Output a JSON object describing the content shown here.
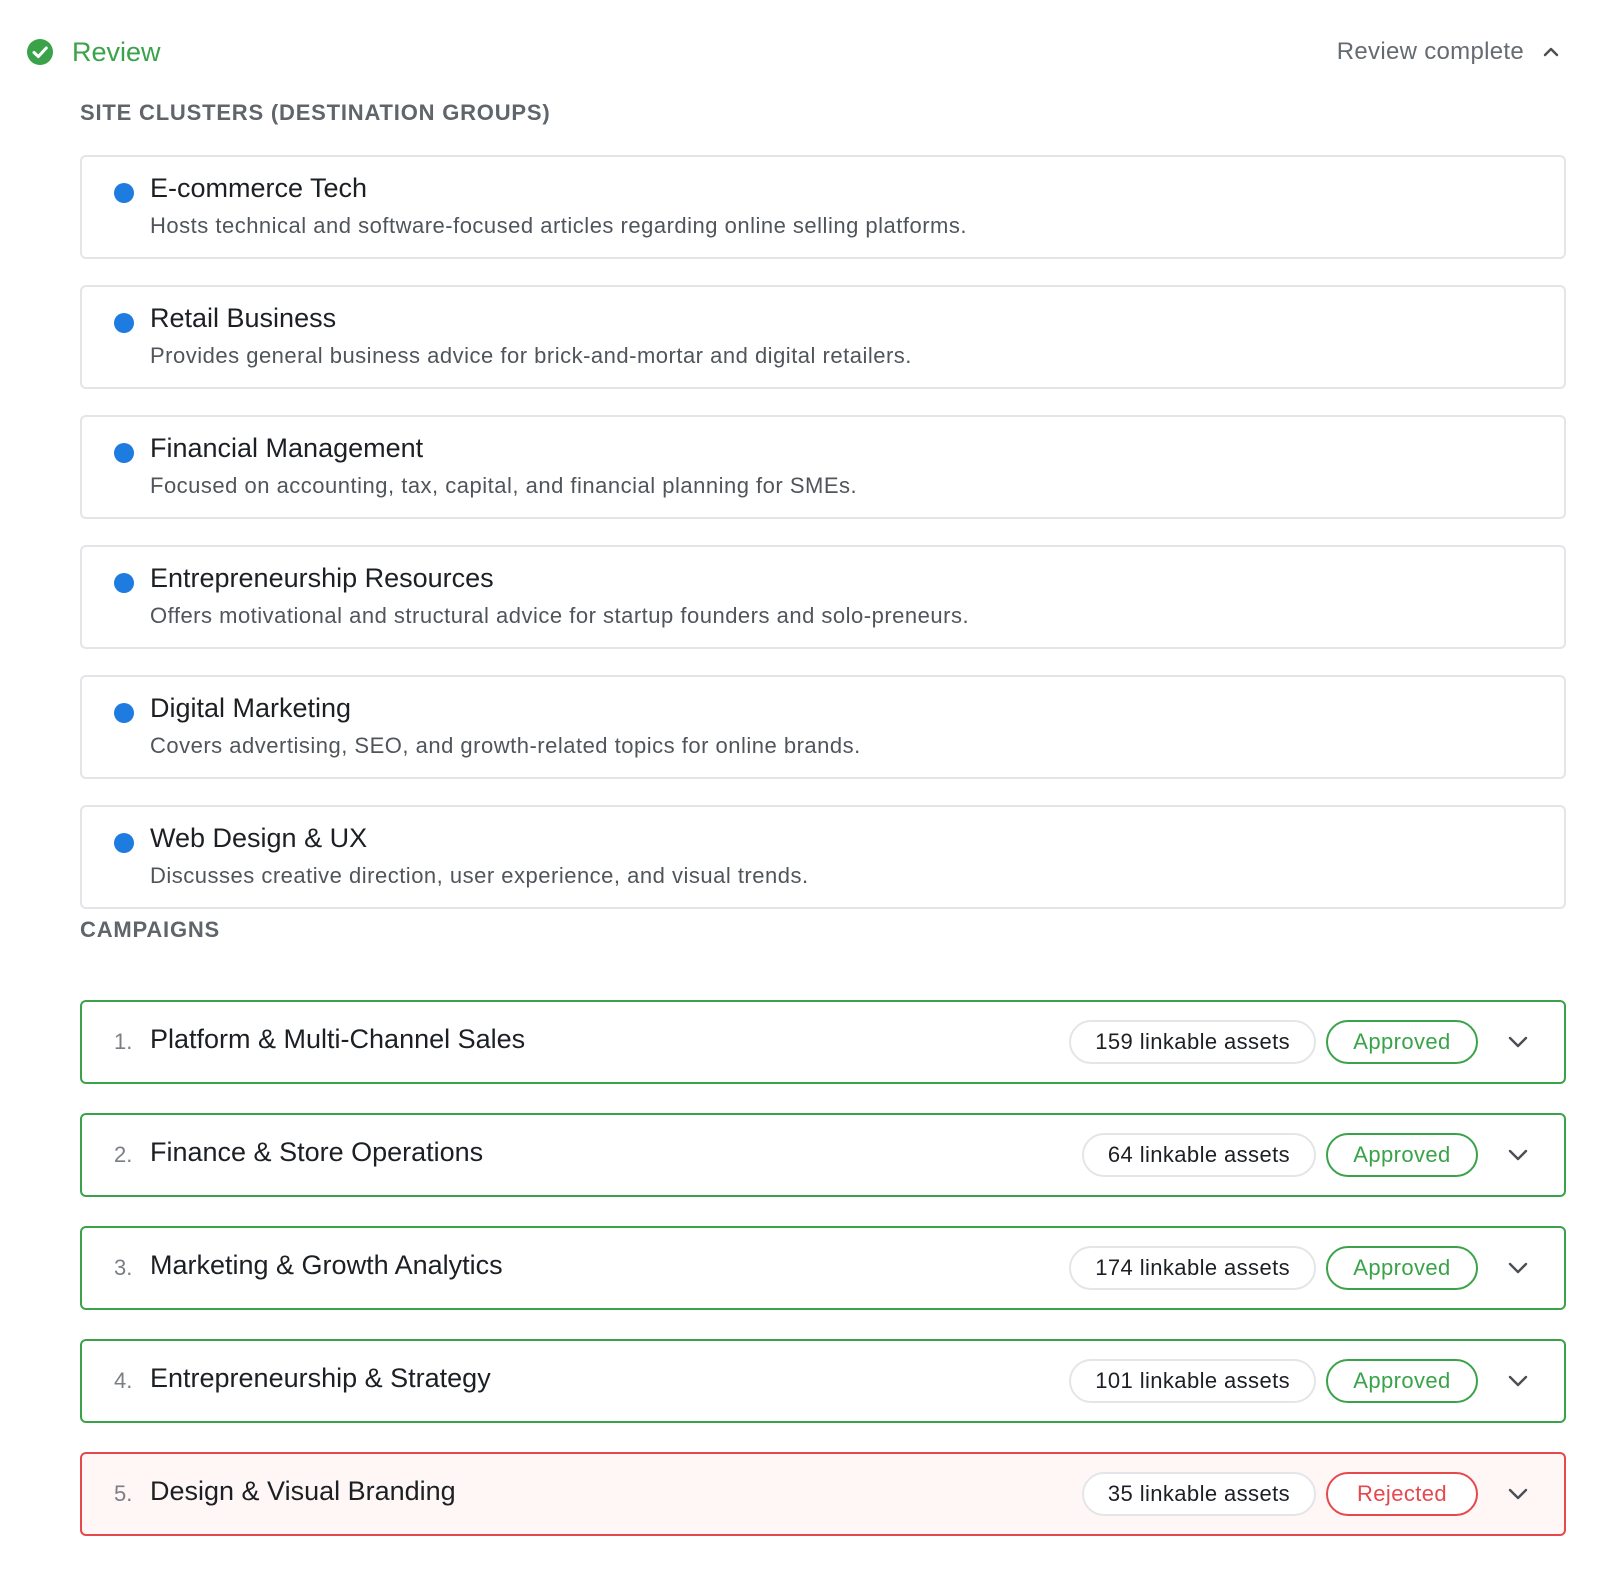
{
  "header": {
    "title": "Review",
    "status": "Review complete",
    "accent_color": "#3aa34a"
  },
  "clusters_section": {
    "label": "SITE CLUSTERS (DESTINATION GROUPS)",
    "dot_color": "#1e7be0",
    "items": [
      {
        "name": "E-commerce Tech",
        "description": "Hosts technical and software-focused articles regarding online selling platforms."
      },
      {
        "name": "Retail Business",
        "description": "Provides general business advice for brick-and-mortar and digital retailers."
      },
      {
        "name": "Financial Management",
        "description": "Focused on accounting, tax, capital, and financial planning for SMEs."
      },
      {
        "name": "Entrepreneurship Resources",
        "description": "Offers motivational and structural advice for startup founders and solo-preneurs."
      },
      {
        "name": "Digital Marketing",
        "description": "Covers advertising, SEO, and growth-related topics for online brands."
      },
      {
        "name": "Web Design & UX",
        "description": "Discusses creative direction, user experience, and visual trends."
      }
    ]
  },
  "campaigns_section": {
    "label": "CAMPAIGNS",
    "approved_color": "#3aa34a",
    "rejected_color": "#e5484d",
    "items": [
      {
        "index": "1.",
        "title": "Platform & Multi-Channel Sales",
        "assets": "159 linkable assets",
        "status": "Approved",
        "state": "approved"
      },
      {
        "index": "2.",
        "title": "Finance & Store Operations",
        "assets": "64 linkable assets",
        "status": "Approved",
        "state": "approved"
      },
      {
        "index": "3.",
        "title": "Marketing & Growth Analytics",
        "assets": "174 linkable assets",
        "status": "Approved",
        "state": "approved"
      },
      {
        "index": "4.",
        "title": "Entrepreneurship & Strategy",
        "assets": "101 linkable assets",
        "status": "Approved",
        "state": "approved"
      },
      {
        "index": "5.",
        "title": "Design & Visual Branding",
        "assets": "35 linkable assets",
        "status": "Rejected",
        "state": "rejected"
      }
    ]
  },
  "icons": {
    "header_status": "check-circle-icon",
    "collapse": "chevron-up-icon",
    "expand": "chevron-down-icon"
  }
}
